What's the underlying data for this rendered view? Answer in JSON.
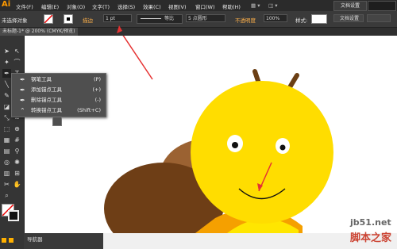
{
  "app": {
    "logo": "Ai"
  },
  "menubar": {
    "items": [
      "文件(F)",
      "编辑(E)",
      "对象(O)",
      "文字(T)",
      "选择(S)",
      "效果(C)",
      "视图(V)",
      "窗口(W)",
      "帮助(H)"
    ],
    "workspace_button": "文档设置"
  },
  "control": {
    "selection_label": "未选择对象",
    "stroke_label": "描边",
    "stroke_weight": "1 pt",
    "profile_label": "等比",
    "brush_label": "5 点圆形",
    "opacity_label": "不透明度",
    "opacity_value": "100%",
    "style_label": "样式:",
    "doc_settings": "文档设置"
  },
  "document": {
    "tab_label": "未标题-1* @ 200% (CMYK/预览)"
  },
  "flyout": {
    "items": [
      {
        "label": "钢笔工具",
        "shortcut": "(P)",
        "icon": "pen-icon"
      },
      {
        "label": "添加锚点工具",
        "shortcut": "(+)",
        "icon": "add-anchor-icon"
      },
      {
        "label": "删除锚点工具",
        "shortcut": "(-)",
        "icon": "delete-anchor-icon"
      },
      {
        "label": "转换锚点工具",
        "shortcut": "(Shift+C)",
        "icon": "convert-anchor-icon"
      }
    ]
  },
  "navigator": {
    "label": "导航器"
  },
  "watermark": {
    "site": "jb51.net",
    "name": "脚本之家"
  },
  "colors": {
    "head": "#ffdd00",
    "shell": "#7a4a1f",
    "shell_light": "#9b6232",
    "antenna": "#6b3f14",
    "body": "#f5a000",
    "arrow": "#e63232"
  }
}
